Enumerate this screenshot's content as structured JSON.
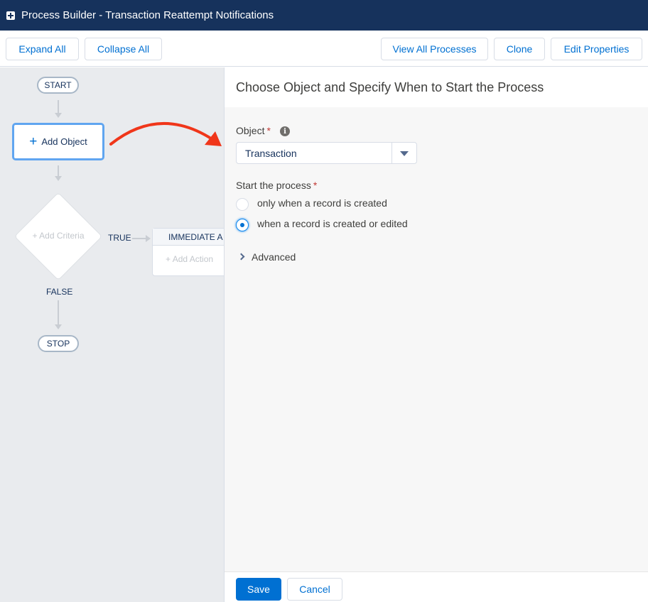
{
  "window": {
    "title": "Process Builder - Transaction Reattempt Notifications"
  },
  "toolbar": {
    "expand_all": "Expand All",
    "collapse_all": "Collapse All",
    "view_all_processes": "View All Processes",
    "clone": "Clone",
    "edit_properties": "Edit Properties"
  },
  "canvas": {
    "start": "START",
    "add_object": "Add Object",
    "add_criteria": "Add Criteria",
    "true_label": "TRUE",
    "immediate_actions": "IMMEDIATE A",
    "add_action": "Add Action",
    "false_label": "FALSE",
    "stop": "STOP"
  },
  "panel": {
    "title": "Choose Object and Specify When to Start the Process",
    "object_label": "Object",
    "required_mark": "*",
    "object_value": "Transaction",
    "start_label": "Start the process",
    "options": [
      {
        "label": "only when a record is created",
        "selected": false
      },
      {
        "label": "when a record is created or edited",
        "selected": true
      }
    ],
    "advanced": "Advanced",
    "save": "Save",
    "cancel": "Cancel"
  },
  "colors": {
    "header": "#16325c",
    "brand": "#0070d2",
    "annotation_arrow": "#f0361a"
  }
}
